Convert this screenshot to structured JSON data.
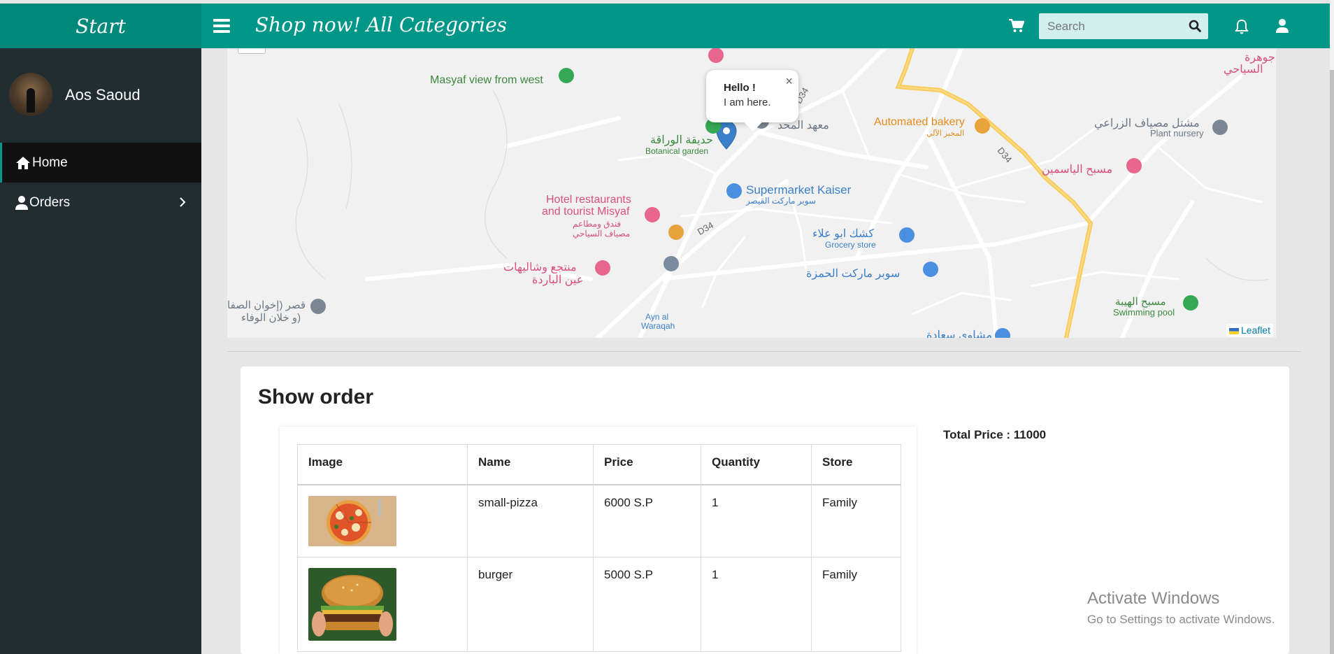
{
  "topbar": {
    "brand": "Start",
    "links": [
      "Shop now!",
      "All Categories"
    ],
    "search_placeholder": "Search"
  },
  "sidebar": {
    "user_name": "Aos Saoud",
    "items": [
      {
        "label": "Home"
      },
      {
        "label": "Orders"
      }
    ]
  },
  "map": {
    "popup_title": "Hello !",
    "popup_text": "I am here.",
    "attribution": "Leaflet",
    "places": [
      "Masyaf view from west",
      "Automated bakery",
      "المخبز الآلي",
      "مشتل مصياف الزراعي",
      "Plant nursery",
      "حديقة الوراقة",
      "Botanical garden",
      "معهد المحد",
      "مسبح الياسمين",
      "Supermarket Kaiser",
      "سوبر ماركت القيصر",
      "Hotel restaurants",
      "and tourist Misyaf",
      "فندق ومطاعم",
      "مصياف السياحي",
      "كشك ابو علاء",
      "Grocery store",
      "منتجع وشاليهات",
      "عين الباردة",
      "سوبر ماركت الحمزة",
      "قصر (إخوان الصفا",
      "و خلان الوفاء)",
      "Ayn al",
      "Waraqah",
      "مسبح الهيبة",
      "Swimming pool",
      "جوهرة",
      "السياحي",
      "مشاوي سعادة",
      "D34"
    ]
  },
  "order": {
    "title": "Show order",
    "total_label": "Total Price : 11000",
    "columns": [
      "Image",
      "Name",
      "Price",
      "Quantity",
      "Store"
    ],
    "rows": [
      {
        "image": "pizza-image",
        "name": "small-pizza",
        "price": "6000 S.P",
        "quantity": "1",
        "store": "Family"
      },
      {
        "image": "burger-image",
        "name": "burger",
        "price": "5000 S.P",
        "quantity": "1",
        "store": "Family"
      }
    ]
  },
  "watermark": {
    "line1": "Activate Windows",
    "line2": "Go to Settings to activate Windows."
  },
  "colors": {
    "topbar": "#009688",
    "brand_bg": "#00897b",
    "sidebar": "#222d32",
    "active_item": "#111111"
  }
}
